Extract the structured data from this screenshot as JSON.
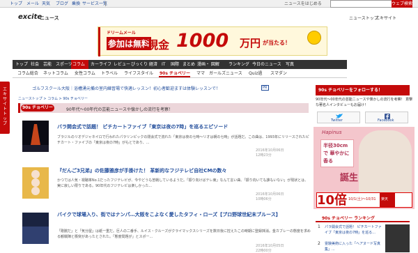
{
  "global_nav": {
    "items": [
      "トップ",
      "メール",
      "天気",
      "ブログ",
      "乗換",
      "サービス一覧"
    ],
    "notice": "ニュースをはじめる",
    "search_button": "ウェブ検索"
  },
  "header": {
    "logo_text": "excite",
    "logo_suffix": "ニュース",
    "news_top": "ニューストップ",
    "excite_link": "エキサイト"
  },
  "banner": {
    "line1": "ドリームメール",
    "line2": "参加は無料",
    "line3": "現金",
    "line4": "1000",
    "line5": "万円",
    "line6": "が当たる！"
  },
  "nav_main": [
    "トップ",
    "社会",
    "芸能",
    "スポーツ",
    "コラム",
    "カーライフ",
    "レビュー",
    "びっくり",
    "経済",
    "IT",
    "国際",
    "まとめ",
    "漫画・ 図解",
    "ランキング",
    "今日のニュース",
    "写真"
  ],
  "nav_sub": [
    "コラム総合",
    "ネットコラム",
    "女性コラム",
    "トラベル",
    "ライフスタイル",
    "90s チョベリー",
    "ママ",
    "ガールズニュース",
    "Quiz過",
    "スマダン"
  ],
  "side_tab": "エキサイトトップ",
  "promo": {
    "text": "ゴルフスクール大阪｜浴槽湧元備の室内練習場で快適レッスン！初心者歓迎ますは体験レッスンで！",
    "badge": "PR"
  },
  "breadcrumbs": "ニューストップ > コラム > 90s チョベリー",
  "category": {
    "badge": "90s チョベリー",
    "desc": "90年代〜00年代の芸能ニュースや懐かしの流行を考察！"
  },
  "articles": [
    {
      "title": "バラ開会式で話題！ ピチカートファイブ「東京は夜の7時」を巡るエピソード",
      "body": "ブラジルのリオデジャネイロで行われたパラリンピックの閉会式で流れた「東京は夜の七時〜リオは朝の七時」が話題だ。この曲は、1993年にリリースされたピチカート・ファイブの「東京は夜の7時」がもとであり、...",
      "date": "2016年10月06日 12時23分"
    },
    {
      "title": "『だんご3兄弟』の佐藤雅彦が手掛けた！ 革新的なフジテレビ自社CMの数々",
      "body": "かつては人気・視聴率No.1だったフジテレビが、今やどうも苦戦しているようだ。「振り向けばテレ東」なんて言い曲、「振り向いても誰もいない」が現状とは、実に寂しい限りである。90年代のフジテレビは楽しかった...",
      "date": "2016年10月06日 10時06分"
    },
    {
      "title": "バイクで球場入り、街ではナンパ…大阪をこよなく愛したタフィ・ローズ【プロ野球世紀末ブルース】",
      "body": "「剛腕だ」と「気分屋」は紙一重だ。巨人の二番手、ルイス・クルーズがクライマックスシリーズを数日後に控えたこの時期に登録抹消。金カブレーの態度を求める観戦陣と衝突があったとされた。「態度問題が」とスポー...",
      "date": "2016年10月05日 22時00分"
    }
  ],
  "right": {
    "follow": "90s チョベリーをフォローする！",
    "desc": "90年代〜00年代の芸能ニュースや懐かしの流行を考察！ 意撃な著名人インタビューもお届け！",
    "twitter": "Twitter",
    "facebook": "Facebook",
    "ad": {
      "brand": "Hapinus",
      "box_line": "半径30cmで 華やかに香る",
      "big": "誕生",
      "bottom_big": "10倍",
      "bottom_date": "10/1(土)〜10/31",
      "raku": "楽天"
    },
    "ranking_title": "90s チョベリー ランキング",
    "ranking": [
      "パラ開会式で話題！ ピチカートファイブ「東京は夜の7時」を巡る...",
      "霊験美術に入った「ヘアヌード写真集」..."
    ]
  },
  "colors": {
    "accent": "#c40a0a",
    "link": "#1f4b9a"
  }
}
